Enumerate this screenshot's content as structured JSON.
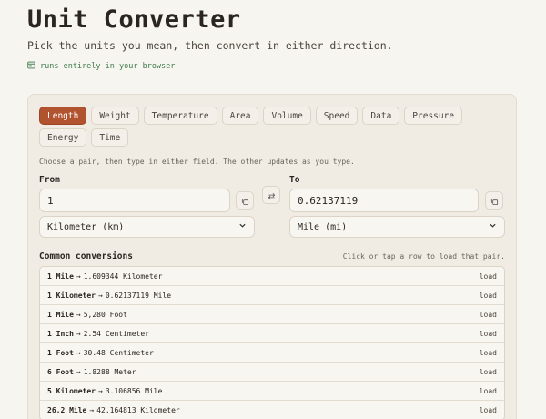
{
  "header": {
    "title": "Unit Converter",
    "subtitle": "Pick the units you mean, then convert in either direction.",
    "privacy_note": "runs entirely in your browser"
  },
  "tabs": [
    {
      "label": "Length",
      "active": true
    },
    {
      "label": "Weight",
      "active": false
    },
    {
      "label": "Temperature",
      "active": false
    },
    {
      "label": "Area",
      "active": false
    },
    {
      "label": "Volume",
      "active": false
    },
    {
      "label": "Speed",
      "active": false
    },
    {
      "label": "Data",
      "active": false
    },
    {
      "label": "Pressure",
      "active": false
    },
    {
      "label": "Energy",
      "active": false
    },
    {
      "label": "Time",
      "active": false
    }
  ],
  "hint": "Choose a pair, then type in either field. The other updates as you type.",
  "from": {
    "label": "From",
    "value": "1",
    "unit": "Kilometer (km)"
  },
  "to": {
    "label": "To",
    "value": "0.62137119",
    "unit": "Mile (mi)"
  },
  "common": {
    "title": "Common conversions",
    "hint": "Click or tap a row to load that pair.",
    "load_label": "load",
    "rows": [
      {
        "from_qty": "1 Mile",
        "to_value": "1.609344 Kilometer"
      },
      {
        "from_qty": "1 Kilometer",
        "to_value": "0.62137119 Mile"
      },
      {
        "from_qty": "1 Mile",
        "to_value": "5,280 Foot"
      },
      {
        "from_qty": "1 Inch",
        "to_value": "2.54 Centimeter"
      },
      {
        "from_qty": "1 Foot",
        "to_value": "30.48 Centimeter"
      },
      {
        "from_qty": "6 Foot",
        "to_value": "1.8288 Meter"
      },
      {
        "from_qty": "5 Kilometer",
        "to_value": "3.106856 Mile"
      },
      {
        "from_qty": "26.2 Mile",
        "to_value": "42.164813 Kilometer"
      }
    ]
  },
  "colors": {
    "accent": "#b2532f",
    "privacy_green": "#3f7a4f",
    "background": "#f7f5ef"
  }
}
